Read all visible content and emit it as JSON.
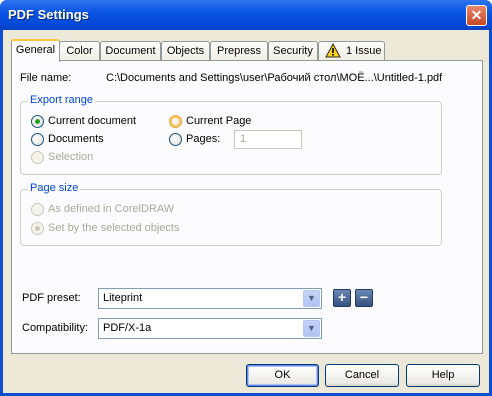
{
  "window": {
    "title": "PDF Settings",
    "close_glyph": "✕"
  },
  "tabs": [
    {
      "label": "General"
    },
    {
      "label": "Color"
    },
    {
      "label": "Document"
    },
    {
      "label": "Objects"
    },
    {
      "label": "Prepress"
    },
    {
      "label": "Security"
    },
    {
      "label": "1 Issue",
      "icon": "warning-icon"
    }
  ],
  "general": {
    "file_name_label": "File name:",
    "file_name_value": "C:\\Documents and Settings\\user\\Рабочий стол\\МОЁ...\\Untitled-1.pdf",
    "export_range": {
      "title": "Export range",
      "current_document": "Current document",
      "current_page": "Current Page",
      "documents": "Documents",
      "pages": "Pages:",
      "pages_value": "1",
      "selection": "Selection",
      "selected": "current_document"
    },
    "page_size": {
      "title": "Page size",
      "as_defined": "As defined in CorelDRAW",
      "set_by_selected": "Set by the selected objects",
      "selected": "set_by_selected"
    },
    "pdf_preset_label": "PDF preset:",
    "pdf_preset_value": "Liteprint",
    "compatibility_label": "Compatibility:",
    "compatibility_value": "PDF/X-1a"
  },
  "buttons": {
    "ok": "OK",
    "cancel": "Cancel",
    "help": "Help",
    "add": "+",
    "remove": "−",
    "dropdown": "▼"
  },
  "colors": {
    "accent": "#0046d5",
    "radio_check": "#21a121",
    "tab_highlight": "#ffc83c",
    "title_bar": "#0a56e2"
  }
}
